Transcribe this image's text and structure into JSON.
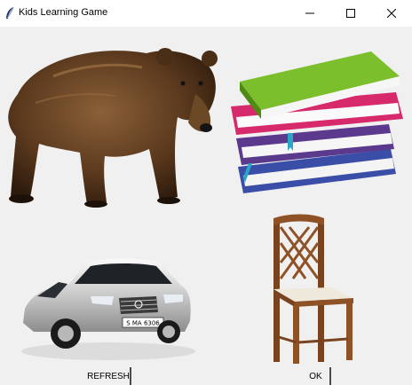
{
  "window": {
    "title": "Kids Learning Game",
    "controls": [
      "minimize-icon",
      "maximize-icon",
      "close-icon"
    ]
  },
  "images": [
    "bear",
    "books",
    "car",
    "chair"
  ],
  "buttons": {
    "refresh": "REFRESH",
    "ok": "OK"
  },
  "car": {
    "plate": "S MA 6306"
  },
  "colors": {
    "background": "#f0f0f0",
    "titlebar": "#ffffff"
  }
}
